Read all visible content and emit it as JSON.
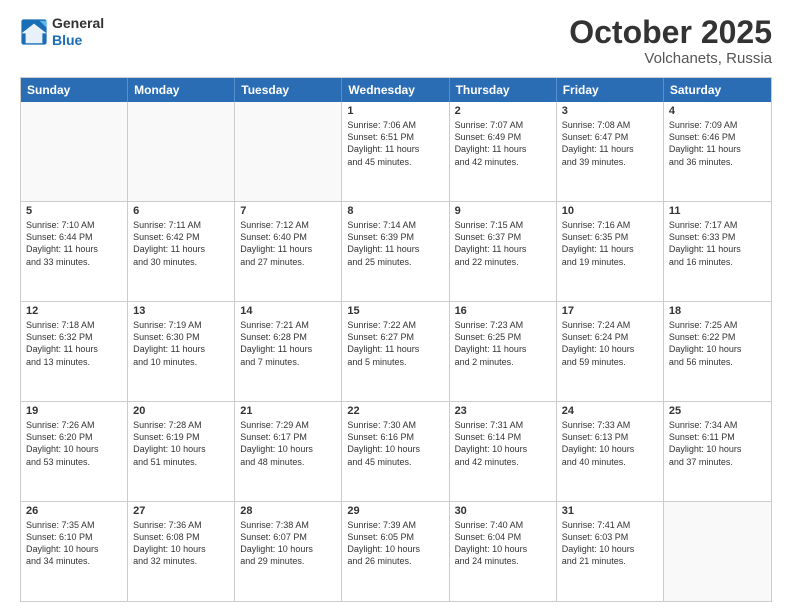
{
  "header": {
    "logo": {
      "general": "General",
      "blue": "Blue"
    },
    "title": "October 2025",
    "location": "Volchanets, Russia"
  },
  "weekdays": [
    "Sunday",
    "Monday",
    "Tuesday",
    "Wednesday",
    "Thursday",
    "Friday",
    "Saturday"
  ],
  "rows": [
    [
      {
        "day": "",
        "text": ""
      },
      {
        "day": "",
        "text": ""
      },
      {
        "day": "",
        "text": ""
      },
      {
        "day": "1",
        "text": "Sunrise: 7:06 AM\nSunset: 6:51 PM\nDaylight: 11 hours\nand 45 minutes."
      },
      {
        "day": "2",
        "text": "Sunrise: 7:07 AM\nSunset: 6:49 PM\nDaylight: 11 hours\nand 42 minutes."
      },
      {
        "day": "3",
        "text": "Sunrise: 7:08 AM\nSunset: 6:47 PM\nDaylight: 11 hours\nand 39 minutes."
      },
      {
        "day": "4",
        "text": "Sunrise: 7:09 AM\nSunset: 6:46 PM\nDaylight: 11 hours\nand 36 minutes."
      }
    ],
    [
      {
        "day": "5",
        "text": "Sunrise: 7:10 AM\nSunset: 6:44 PM\nDaylight: 11 hours\nand 33 minutes."
      },
      {
        "day": "6",
        "text": "Sunrise: 7:11 AM\nSunset: 6:42 PM\nDaylight: 11 hours\nand 30 minutes."
      },
      {
        "day": "7",
        "text": "Sunrise: 7:12 AM\nSunset: 6:40 PM\nDaylight: 11 hours\nand 27 minutes."
      },
      {
        "day": "8",
        "text": "Sunrise: 7:14 AM\nSunset: 6:39 PM\nDaylight: 11 hours\nand 25 minutes."
      },
      {
        "day": "9",
        "text": "Sunrise: 7:15 AM\nSunset: 6:37 PM\nDaylight: 11 hours\nand 22 minutes."
      },
      {
        "day": "10",
        "text": "Sunrise: 7:16 AM\nSunset: 6:35 PM\nDaylight: 11 hours\nand 19 minutes."
      },
      {
        "day": "11",
        "text": "Sunrise: 7:17 AM\nSunset: 6:33 PM\nDaylight: 11 hours\nand 16 minutes."
      }
    ],
    [
      {
        "day": "12",
        "text": "Sunrise: 7:18 AM\nSunset: 6:32 PM\nDaylight: 11 hours\nand 13 minutes."
      },
      {
        "day": "13",
        "text": "Sunrise: 7:19 AM\nSunset: 6:30 PM\nDaylight: 11 hours\nand 10 minutes."
      },
      {
        "day": "14",
        "text": "Sunrise: 7:21 AM\nSunset: 6:28 PM\nDaylight: 11 hours\nand 7 minutes."
      },
      {
        "day": "15",
        "text": "Sunrise: 7:22 AM\nSunset: 6:27 PM\nDaylight: 11 hours\nand 5 minutes."
      },
      {
        "day": "16",
        "text": "Sunrise: 7:23 AM\nSunset: 6:25 PM\nDaylight: 11 hours\nand 2 minutes."
      },
      {
        "day": "17",
        "text": "Sunrise: 7:24 AM\nSunset: 6:24 PM\nDaylight: 10 hours\nand 59 minutes."
      },
      {
        "day": "18",
        "text": "Sunrise: 7:25 AM\nSunset: 6:22 PM\nDaylight: 10 hours\nand 56 minutes."
      }
    ],
    [
      {
        "day": "19",
        "text": "Sunrise: 7:26 AM\nSunset: 6:20 PM\nDaylight: 10 hours\nand 53 minutes."
      },
      {
        "day": "20",
        "text": "Sunrise: 7:28 AM\nSunset: 6:19 PM\nDaylight: 10 hours\nand 51 minutes."
      },
      {
        "day": "21",
        "text": "Sunrise: 7:29 AM\nSunset: 6:17 PM\nDaylight: 10 hours\nand 48 minutes."
      },
      {
        "day": "22",
        "text": "Sunrise: 7:30 AM\nSunset: 6:16 PM\nDaylight: 10 hours\nand 45 minutes."
      },
      {
        "day": "23",
        "text": "Sunrise: 7:31 AM\nSunset: 6:14 PM\nDaylight: 10 hours\nand 42 minutes."
      },
      {
        "day": "24",
        "text": "Sunrise: 7:33 AM\nSunset: 6:13 PM\nDaylight: 10 hours\nand 40 minutes."
      },
      {
        "day": "25",
        "text": "Sunrise: 7:34 AM\nSunset: 6:11 PM\nDaylight: 10 hours\nand 37 minutes."
      }
    ],
    [
      {
        "day": "26",
        "text": "Sunrise: 7:35 AM\nSunset: 6:10 PM\nDaylight: 10 hours\nand 34 minutes."
      },
      {
        "day": "27",
        "text": "Sunrise: 7:36 AM\nSunset: 6:08 PM\nDaylight: 10 hours\nand 32 minutes."
      },
      {
        "day": "28",
        "text": "Sunrise: 7:38 AM\nSunset: 6:07 PM\nDaylight: 10 hours\nand 29 minutes."
      },
      {
        "day": "29",
        "text": "Sunrise: 7:39 AM\nSunset: 6:05 PM\nDaylight: 10 hours\nand 26 minutes."
      },
      {
        "day": "30",
        "text": "Sunrise: 7:40 AM\nSunset: 6:04 PM\nDaylight: 10 hours\nand 24 minutes."
      },
      {
        "day": "31",
        "text": "Sunrise: 7:41 AM\nSunset: 6:03 PM\nDaylight: 10 hours\nand 21 minutes."
      },
      {
        "day": "",
        "text": ""
      }
    ]
  ]
}
